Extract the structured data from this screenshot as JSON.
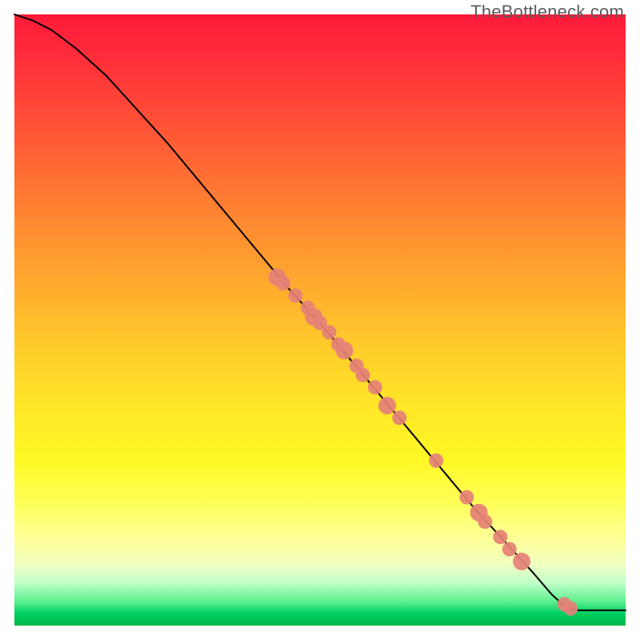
{
  "watermark": "TheBottleneck.com",
  "chart_data": {
    "type": "line",
    "title": "",
    "xlabel": "",
    "ylabel": "",
    "xlim": [
      0,
      100
    ],
    "ylim": [
      0,
      100
    ],
    "curve": [
      {
        "x": 0.0,
        "y": 100.0
      },
      {
        "x": 3.0,
        "y": 99.0
      },
      {
        "x": 6.0,
        "y": 97.5
      },
      {
        "x": 10.0,
        "y": 94.5
      },
      {
        "x": 15.0,
        "y": 90.0
      },
      {
        "x": 20.0,
        "y": 84.5
      },
      {
        "x": 25.0,
        "y": 79.0
      },
      {
        "x": 30.0,
        "y": 73.0
      },
      {
        "x": 35.0,
        "y": 67.0
      },
      {
        "x": 40.0,
        "y": 61.0
      },
      {
        "x": 45.0,
        "y": 55.0
      },
      {
        "x": 50.0,
        "y": 49.5
      },
      {
        "x": 55.0,
        "y": 43.5
      },
      {
        "x": 60.0,
        "y": 37.5
      },
      {
        "x": 65.0,
        "y": 31.5
      },
      {
        "x": 70.0,
        "y": 25.5
      },
      {
        "x": 75.0,
        "y": 19.5
      },
      {
        "x": 80.0,
        "y": 14.0
      },
      {
        "x": 85.0,
        "y": 8.5
      },
      {
        "x": 88.0,
        "y": 5.0
      },
      {
        "x": 90.5,
        "y": 2.8
      },
      {
        "x": 92.0,
        "y": 2.5
      },
      {
        "x": 100.0,
        "y": 2.5
      }
    ],
    "markers": [
      {
        "x": 43,
        "y": 57
      },
      {
        "x": 44,
        "y": 56
      },
      {
        "x": 46,
        "y": 54
      },
      {
        "x": 48,
        "y": 52
      },
      {
        "x": 49,
        "y": 50.5
      },
      {
        "x": 50,
        "y": 49.5
      },
      {
        "x": 51.5,
        "y": 48
      },
      {
        "x": 53,
        "y": 46
      },
      {
        "x": 54,
        "y": 45
      },
      {
        "x": 56,
        "y": 42.5
      },
      {
        "x": 57,
        "y": 41
      },
      {
        "x": 59,
        "y": 39
      },
      {
        "x": 61,
        "y": 36
      },
      {
        "x": 63,
        "y": 34
      },
      {
        "x": 69,
        "y": 27
      },
      {
        "x": 74,
        "y": 21
      },
      {
        "x": 76,
        "y": 18.5
      },
      {
        "x": 77,
        "y": 17
      },
      {
        "x": 79.5,
        "y": 14.5
      },
      {
        "x": 81,
        "y": 12.5
      },
      {
        "x": 83,
        "y": 10.5
      },
      {
        "x": 90,
        "y": 3.5
      },
      {
        "x": 91,
        "y": 2.8
      }
    ],
    "marker_style": {
      "color": "#e58177",
      "radius_large": 11,
      "radius_small": 9
    },
    "line_style": {
      "color": "#000000",
      "width": 2
    },
    "gradient_colors_top_to_bottom": [
      "#ff1a3a",
      "#ffce2b",
      "#ffff5a",
      "#00b84a"
    ]
  }
}
